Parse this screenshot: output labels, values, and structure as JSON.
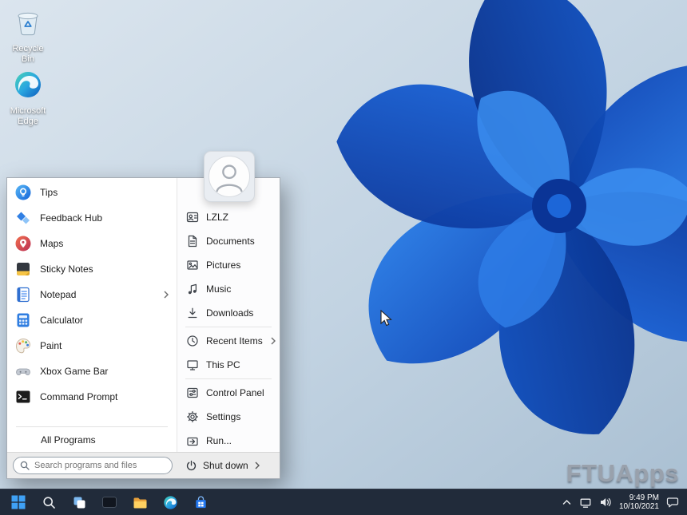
{
  "desktop": {
    "icons": [
      {
        "label": "Recycle Bin",
        "icon": "recycle-bin-icon"
      },
      {
        "label": "Microsoft Edge",
        "icon": "edge-icon"
      }
    ],
    "watermark": "FTUApps"
  },
  "start_menu": {
    "left_items": [
      {
        "label": "Tips",
        "icon": "tips-icon"
      },
      {
        "label": "Feedback Hub",
        "icon": "feedback-hub-icon"
      },
      {
        "label": "Maps",
        "icon": "maps-icon"
      },
      {
        "label": "Sticky Notes",
        "icon": "sticky-notes-icon"
      },
      {
        "label": "Notepad",
        "icon": "notepad-icon",
        "has_submenu": true
      },
      {
        "label": "Calculator",
        "icon": "calculator-icon"
      },
      {
        "label": "Paint",
        "icon": "paint-icon"
      },
      {
        "label": "Xbox Game Bar",
        "icon": "xbox-icon"
      },
      {
        "label": "Command Prompt",
        "icon": "command-prompt-icon"
      }
    ],
    "all_programs_label": "All Programs",
    "search": {
      "placeholder": "Search programs and files"
    },
    "right_items": [
      {
        "label": "LZLZ",
        "icon": "user-card-icon"
      },
      {
        "label": "Documents",
        "icon": "document-icon"
      },
      {
        "label": "Pictures",
        "icon": "picture-icon"
      },
      {
        "label": "Music",
        "icon": "music-icon"
      },
      {
        "label": "Downloads",
        "icon": "download-icon"
      },
      {
        "label": "Recent Items",
        "icon": "clock-icon",
        "has_submenu": true
      },
      {
        "label": "This PC",
        "icon": "computer-icon"
      },
      {
        "label": "Control Panel",
        "icon": "control-panel-icon"
      },
      {
        "label": "Settings",
        "icon": "gear-icon"
      },
      {
        "label": "Run...",
        "icon": "run-icon"
      }
    ],
    "shutdown_label": "Shut down"
  },
  "taskbar": {
    "buttons": [
      "start",
      "search",
      "task-view",
      "pinned-app",
      "file-explorer",
      "edge",
      "microsoft-store"
    ],
    "tray_icons": [
      "chevron-up",
      "network",
      "volume",
      "notifications"
    ],
    "clock": {
      "time": "9:49 PM",
      "date": "10/10/2021"
    }
  }
}
